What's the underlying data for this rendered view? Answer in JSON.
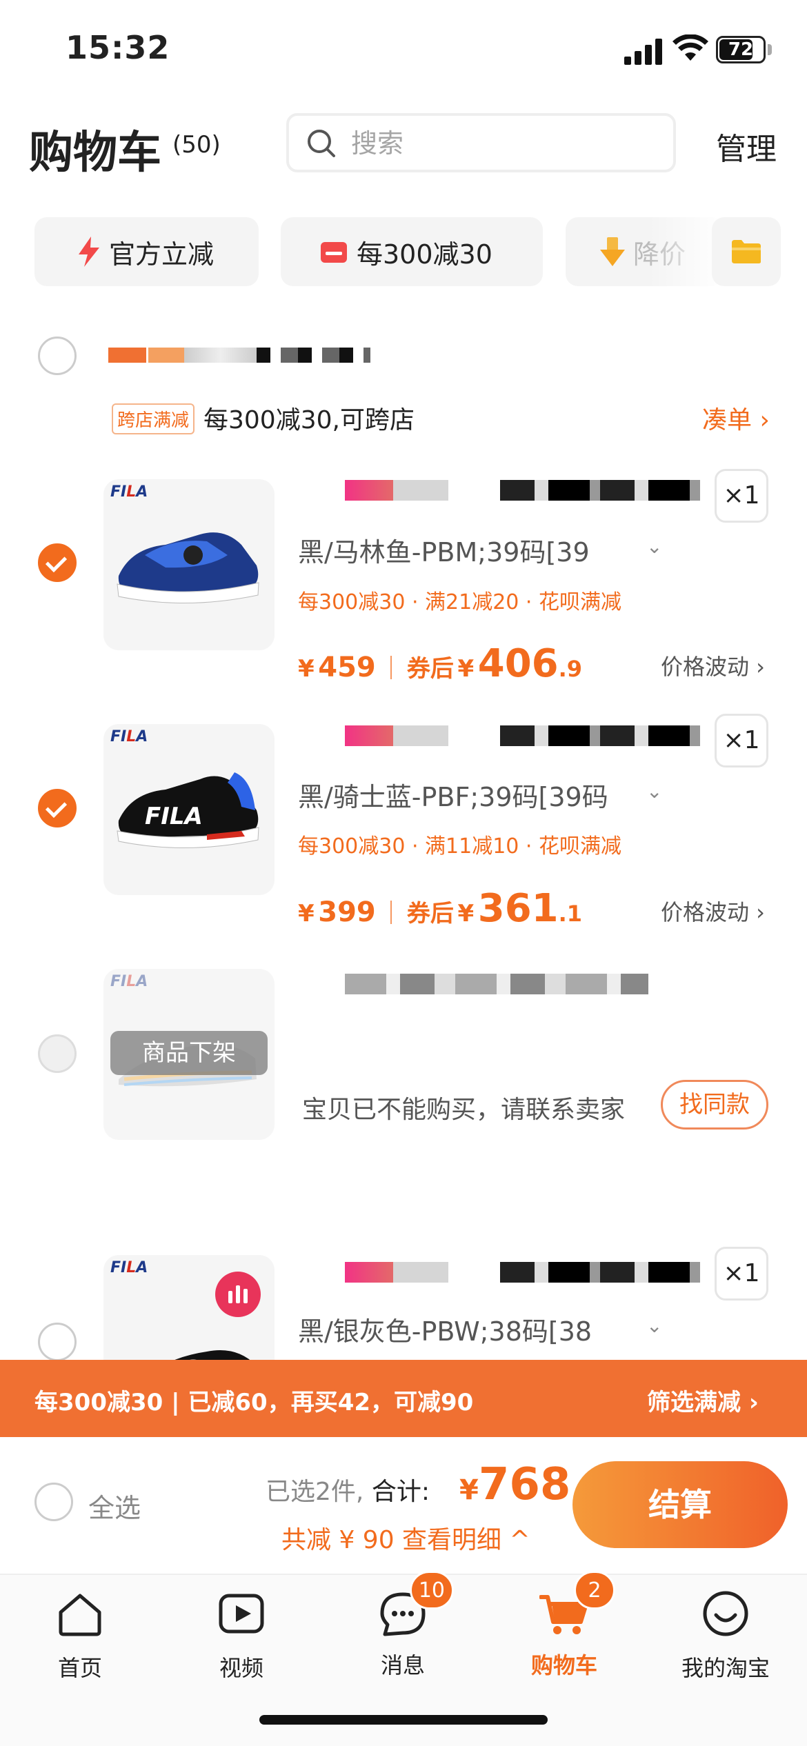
{
  "status_bar": {
    "time": "15:32",
    "battery": "72"
  },
  "header": {
    "title": "购物车",
    "count": "(50)",
    "search_placeholder": "搜索",
    "manage": "管理"
  },
  "chips": [
    {
      "label": "官方立减",
      "icon": "lightning-icon"
    },
    {
      "label": "每300减30",
      "icon": "store-icon"
    },
    {
      "label": "降价",
      "icon": "price-drop-icon"
    },
    {
      "label": "",
      "icon": "folder-icon"
    }
  ],
  "store": {
    "promo_tag": "跨店满减",
    "promo_text": "每300减30,可跨店",
    "coudan": "凑单 ›"
  },
  "items": [
    {
      "brand": "FILA",
      "sku": "黑/马林鱼-PBM;39码[39",
      "deals": "每300减30 · 满21减20 · 花呗满减",
      "price": "459",
      "after_label": "券后",
      "after_int": "406",
      "after_dec": ".9",
      "qty": "×1",
      "fluct": "价格波动 ›",
      "checked": true
    },
    {
      "brand": "FILA",
      "sku": "黑/骑士蓝-PBF;39码[39码",
      "deals": "每300减30 · 满11减10 · 花呗满减",
      "price": "399",
      "after_label": "券后",
      "after_int": "361",
      "after_dec": ".1",
      "qty": "×1",
      "fluct": "价格波动 ›",
      "checked": true
    },
    {
      "brand": "FILA",
      "badge": "商品下架",
      "unavailable_text": "宝贝已不能购买，请联系卖家",
      "find_same": "找同款",
      "checked": false
    },
    {
      "brand": "FILA",
      "sku": "黑/银灰色-PBW;38码[38",
      "qty": "×1",
      "checked": false
    }
  ],
  "banner": {
    "left": "每300减30 | 已减60，再买42，可减90",
    "right": "筛选满减 ›"
  },
  "summary": {
    "select_all": "全选",
    "selected": "已选2件,",
    "total_label": "合计:",
    "currency": "¥",
    "total": "768",
    "reduce": "共减 ¥ 90  查看明细 ^",
    "checkout": "结算"
  },
  "tabbar": [
    {
      "label": "首页",
      "icon": "home-icon"
    },
    {
      "label": "视频",
      "icon": "video-icon"
    },
    {
      "label": "消息",
      "icon": "message-icon",
      "badge": "10"
    },
    {
      "label": "购物车",
      "icon": "cart-icon",
      "badge": "2",
      "active": true
    },
    {
      "label": "我的淘宝",
      "icon": "profile-icon"
    }
  ],
  "colors": {
    "accent": "#f26b1d",
    "banner": "#f07032"
  }
}
